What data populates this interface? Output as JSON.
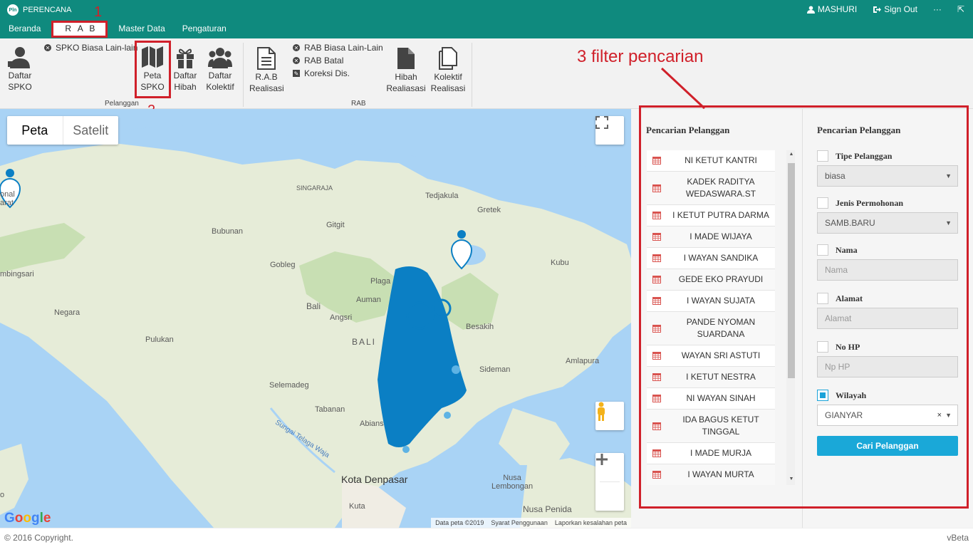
{
  "app": {
    "title": "PERENCANA",
    "logo_text": "Pln"
  },
  "user": {
    "name": "MASHURI",
    "sign_out": "Sign Out",
    "more": "···",
    "external": "⇱"
  },
  "menu": {
    "items": [
      "Beranda",
      "R A B",
      "Master Data",
      "Pengaturan"
    ],
    "active": "R A B"
  },
  "ribbon": {
    "pelanggan_group": "Pelanggan",
    "rab_group": "RAB",
    "daftar_spko": [
      "Daftar",
      "SPKO"
    ],
    "spko_biasa": "SPKO Biasa Lain-lain",
    "peta_spko": [
      "Peta",
      "SPKO"
    ],
    "daftar_hibah": [
      "Daftar",
      "Hibah"
    ],
    "daftar_kolektif": [
      "Daftar",
      "Kolektif"
    ],
    "rab_realisasi": [
      "R.A.B",
      "Realisasi"
    ],
    "rab_biasa": "RAB Biasa Lain-Lain",
    "rab_batal": "RAB Batal",
    "koreksi_dis": "Koreksi Dis.",
    "hibah_realisasi": [
      "Hibah",
      "Realiasasi"
    ],
    "kolektif_realisasi": [
      "Kolektif",
      "Realisasi"
    ]
  },
  "annotations": {
    "one": "1",
    "two": "2",
    "three": "3 filter pencarian"
  },
  "map": {
    "type_map": "Peta",
    "type_satellite": "Satelit",
    "labels": {
      "singaraja": "SINGARAJA",
      "tedjakula": "Tedjakula",
      "gretek": "Gretek",
      "bubunan": "Bubunan",
      "gitgit": "Gitgit",
      "kubu": "Kubu",
      "gobleg": "Gobleg",
      "plaga": "Plaga",
      "bali1": "Bali",
      "auman": "Auman",
      "angsri": "Angsri",
      "negara": "Negara",
      "besakih": "Besakih",
      "bali2": "BALI",
      "pulukan": "Pulukan",
      "amlapura": "Amlapura",
      "sideman": "Sideman",
      "selemadeg": "Selemadeg",
      "tabanan": "Tabanan",
      "sungai": "Sungai Telaga Waja",
      "abiansemal": "Abians",
      "denpasar": "Kota Denpasar",
      "nusa_lembongan": [
        "Nusa",
        "Lembongan"
      ],
      "kuta": "Kuta",
      "nusa_penida": "Nusa Penida",
      "left_edge_1": "mbingsari",
      "left_edge_2": "onal",
      "left_edge_3": "arat",
      "left_edge_4": "o"
    },
    "attribution": [
      "Data peta ©2019",
      "Syarat Penggunaan",
      "Laporkan kesalahan peta"
    ],
    "google": "Google"
  },
  "panel": {
    "list_title": "Pencarian Pelanggan",
    "filter_title": "Pencarian Pelanggan",
    "customers": [
      "NI KETUT KANTRI",
      "KADEK RADITYA WEDASWARA.ST",
      "I KETUT PUTRA DARMA",
      "I MADE WIJAYA",
      "I WAYAN SANDIKA",
      "GEDE EKO PRAYUDI",
      "I WAYAN SUJATA",
      "PANDE NYOMAN SUARDANA",
      "WAYAN SRI ASTUTI",
      "I KETUT NESTRA",
      "NI WAYAN SINAH",
      "IDA BAGUS KETUT TINGGAL",
      "I MADE MURJA",
      "I WAYAN MURTA"
    ],
    "filters": {
      "tipe_label": "Tipe Pelanggan",
      "tipe_value": "biasa",
      "jenis_label": "Jenis Permohonan",
      "jenis_value": "SAMB.BARU",
      "nama_label": "Nama",
      "nama_placeholder": "Nama",
      "alamat_label": "Alamat",
      "alamat_placeholder": "Alamat",
      "nohp_label": "No HP",
      "nohp_placeholder": "Np HP",
      "wilayah_label": "Wilayah",
      "wilayah_value": "GIANYAR",
      "wilayah_checked": true,
      "button": "Cari Pelanggan"
    }
  },
  "footer": {
    "copyright": "© 2016 Copyright.",
    "version": "vBeta"
  },
  "colors": {
    "topbar": "#0f8a7e",
    "accent": "#1aa8d8",
    "annotation": "#d0202a",
    "marker": "#0b7fc4"
  }
}
